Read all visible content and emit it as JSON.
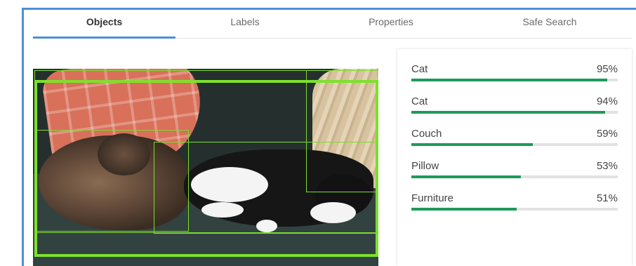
{
  "tabs": [
    {
      "label": "Objects",
      "active": true
    },
    {
      "label": "Labels",
      "active": false
    },
    {
      "label": "Properties",
      "active": false
    },
    {
      "label": "Safe Search",
      "active": false
    }
  ],
  "results": [
    {
      "name": "Cat",
      "score": 0.95,
      "pct": "95%"
    },
    {
      "name": "Cat",
      "score": 0.94,
      "pct": "94%"
    },
    {
      "name": "Couch",
      "score": 0.59,
      "pct": "59%"
    },
    {
      "name": "Pillow",
      "score": 0.53,
      "pct": "53%"
    },
    {
      "name": "Furniture",
      "score": 0.51,
      "pct": "51%"
    }
  ],
  "colors": {
    "accent": "#4a90d9",
    "bar_fill": "#1e9a5a",
    "bar_track": "#e2e2e2",
    "bounding_box": "#7de22a"
  }
}
